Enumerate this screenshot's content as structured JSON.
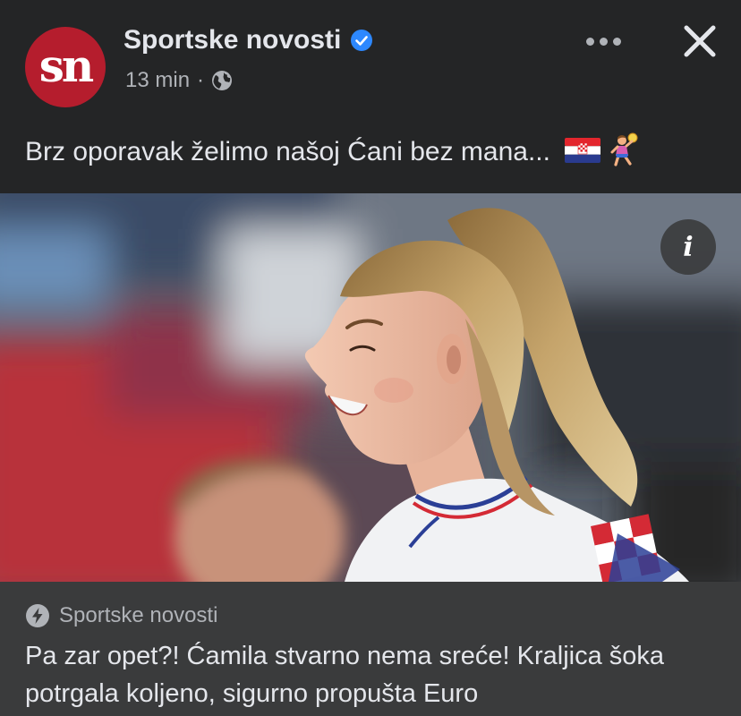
{
  "post": {
    "page_name": "Sportske novosti",
    "avatar_text": "sn",
    "time": "13 min",
    "separator": "·",
    "caption": "Brz oporavak želimo našoj Ćani bez mana...",
    "icons": {
      "verified": "verified-badge-icon",
      "audience": "globe-icon",
      "more": "more-options-icon",
      "close": "close-icon",
      "info": "info-icon",
      "source": "instant-article-bolt-icon"
    },
    "info_label": "i"
  },
  "link_preview": {
    "source": "Sportske novosti",
    "title": "Pa zar opet?! Ćamila stvarno nema sreće! Kraljica šoka potrgala koljeno, sigurno propušta Euro"
  },
  "colors": {
    "background": "#242526",
    "card": "#3a3b3c",
    "text_primary": "#e4e6eb",
    "text_secondary": "#b0b3b8",
    "brand_red": "#b51d2d",
    "verified_blue": "#2d88ff"
  }
}
